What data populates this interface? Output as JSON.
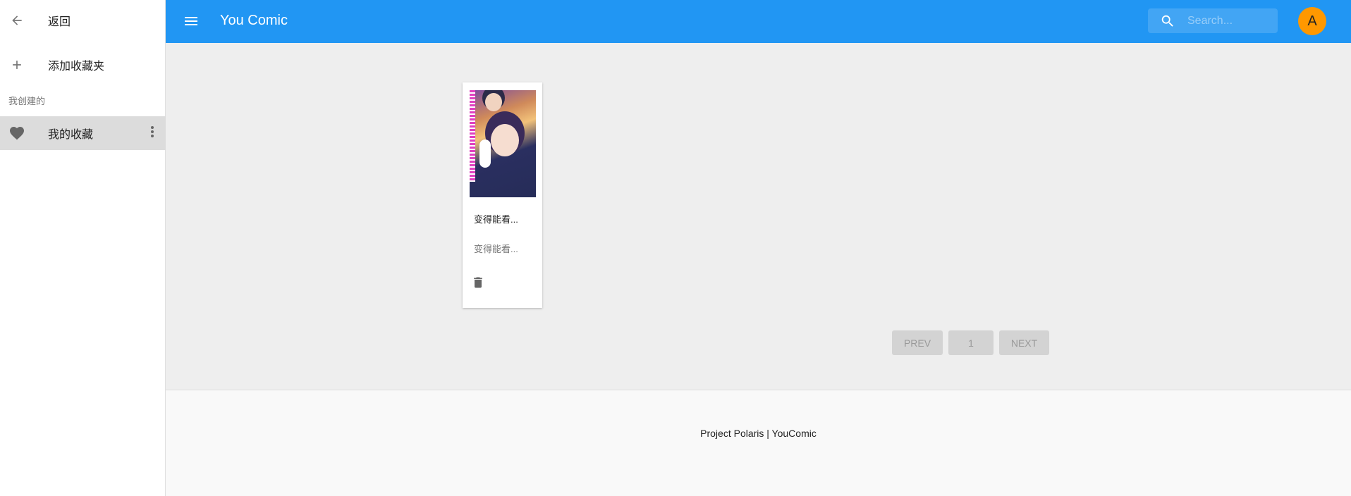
{
  "sidebar": {
    "back": {
      "icon": "arrow-left-icon",
      "label": "返回"
    },
    "add": {
      "icon": "plus-icon",
      "label": "添加收藏夹"
    },
    "section_label": "我创建的",
    "collections": [
      {
        "icon": "heart-icon",
        "label": "我的收藏",
        "selected": true
      }
    ]
  },
  "header": {
    "title": "You Comic",
    "search_placeholder": "Search...",
    "avatar": "A"
  },
  "cards": [
    {
      "title": "变得能看...",
      "subtitle": "变得能看...",
      "action_icon": "trash-icon"
    }
  ],
  "pagination": {
    "prev": "PREV",
    "page": "1",
    "next": "NEXT"
  },
  "footer": {
    "text": "Project Polaris | YouComic"
  },
  "colors": {
    "primary": "#2196f3",
    "avatar": "#ff9800"
  }
}
